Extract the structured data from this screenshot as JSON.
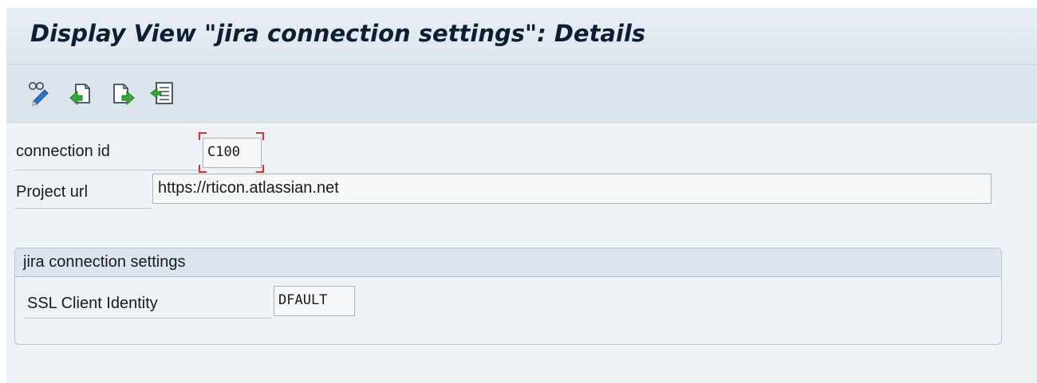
{
  "title": "Display View \"jira connection settings\": Details",
  "toolbar": {
    "buttons": [
      {
        "icon": "display-change-icon"
      },
      {
        "icon": "previous-entry-icon"
      },
      {
        "icon": "next-entry-icon"
      },
      {
        "icon": "variable-list-icon"
      }
    ]
  },
  "form": {
    "connection_id": {
      "label": "connection id",
      "value": "C100"
    },
    "project_url": {
      "label": "Project url",
      "value": "https://rticon.atlassian.net"
    }
  },
  "group": {
    "title": "jira connection settings",
    "ssl_client_identity": {
      "label": "SSL Client Identity",
      "value": "DFAULT"
    }
  },
  "colors": {
    "title_bar": "#dde5ee",
    "toolbar": "#dbe3ec",
    "background": "#eef2f6",
    "focus_marker": "#d9302a",
    "icon_green": "#3aa53a"
  }
}
